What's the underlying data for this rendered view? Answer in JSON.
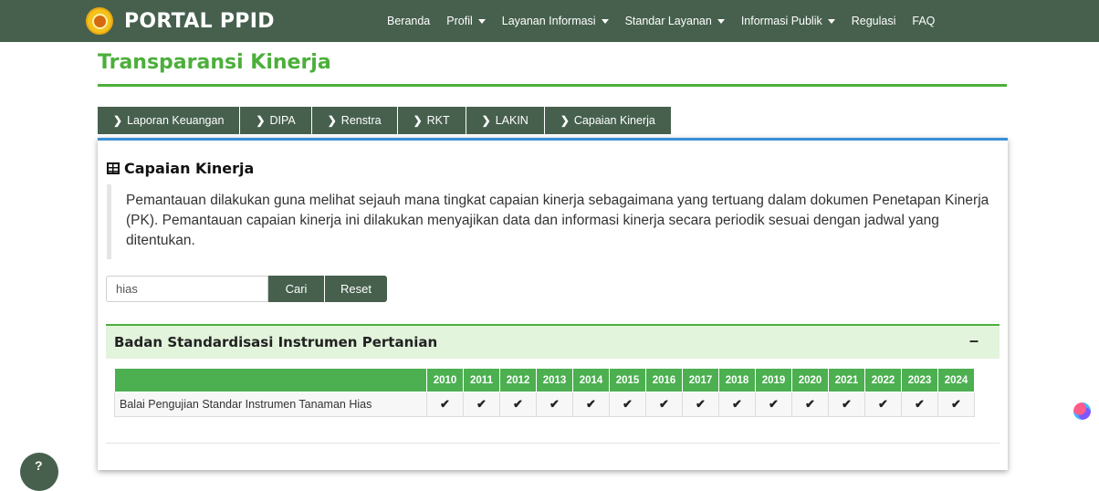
{
  "header": {
    "brand": "PORTAL PPID",
    "nav": [
      {
        "label": "Beranda",
        "dropdown": false
      },
      {
        "label": "Profil",
        "dropdown": true
      },
      {
        "label": "Layanan Informasi",
        "dropdown": true
      },
      {
        "label": "Standar Layanan",
        "dropdown": true
      },
      {
        "label": "Informasi Publik",
        "dropdown": true
      },
      {
        "label": "Regulasi",
        "dropdown": false
      },
      {
        "label": "FAQ",
        "dropdown": false
      }
    ]
  },
  "page": {
    "title": "Transparansi Kinerja"
  },
  "tabs": [
    {
      "label": "Laporan Keuangan",
      "icon": "chevron-right-icon"
    },
    {
      "label": "DIPA",
      "icon": "chevron-right-icon"
    },
    {
      "label": "Renstra",
      "icon": "chevron-right-icon"
    },
    {
      "label": "RKT",
      "icon": "chevron-right-icon"
    },
    {
      "label": "LAKIN",
      "icon": "chevron-right-icon"
    },
    {
      "label": "Capaian Kinerja",
      "icon": "chevron-right-icon"
    }
  ],
  "section": {
    "title": "Capaian Kinerja",
    "icon": "table-icon",
    "description": "Pemantauan dilakukan guna melihat sejauh mana tingkat capaian kinerja sebagaimana yang tertuang dalam dokumen Penetapan Kinerja (PK). Pemantauan capaian kinerja ini dilakukan menyajikan data dan informasi kinerja secara periodik sesuai dengan jadwal yang ditentukan."
  },
  "search": {
    "value": "hias",
    "search_label": "Cari",
    "reset_label": "Reset"
  },
  "panel": {
    "title": "Badan Standardisasi Instrumen Pertanian",
    "collapse_symbol": "–"
  },
  "table": {
    "years": [
      "2010",
      "2011",
      "2012",
      "2013",
      "2014",
      "2015",
      "2016",
      "2017",
      "2018",
      "2019",
      "2020",
      "2021",
      "2022",
      "2023",
      "2024"
    ],
    "rows": [
      {
        "name": "Balai Pengujian Standar Instrumen Tanaman Hias",
        "marks": [
          "✔",
          "✔",
          "✔",
          "✔",
          "✔",
          "✔",
          "✔",
          "✔",
          "✔",
          "✔",
          "✔",
          "✔",
          "✔",
          "✔",
          "✔"
        ]
      }
    ]
  },
  "colors": {
    "navbar": "#46604d",
    "accent_green": "#4caf3b",
    "table_header": "#4caf50",
    "panel_bg": "#e2f4dc",
    "card_top_border": "#3a8fd6"
  }
}
